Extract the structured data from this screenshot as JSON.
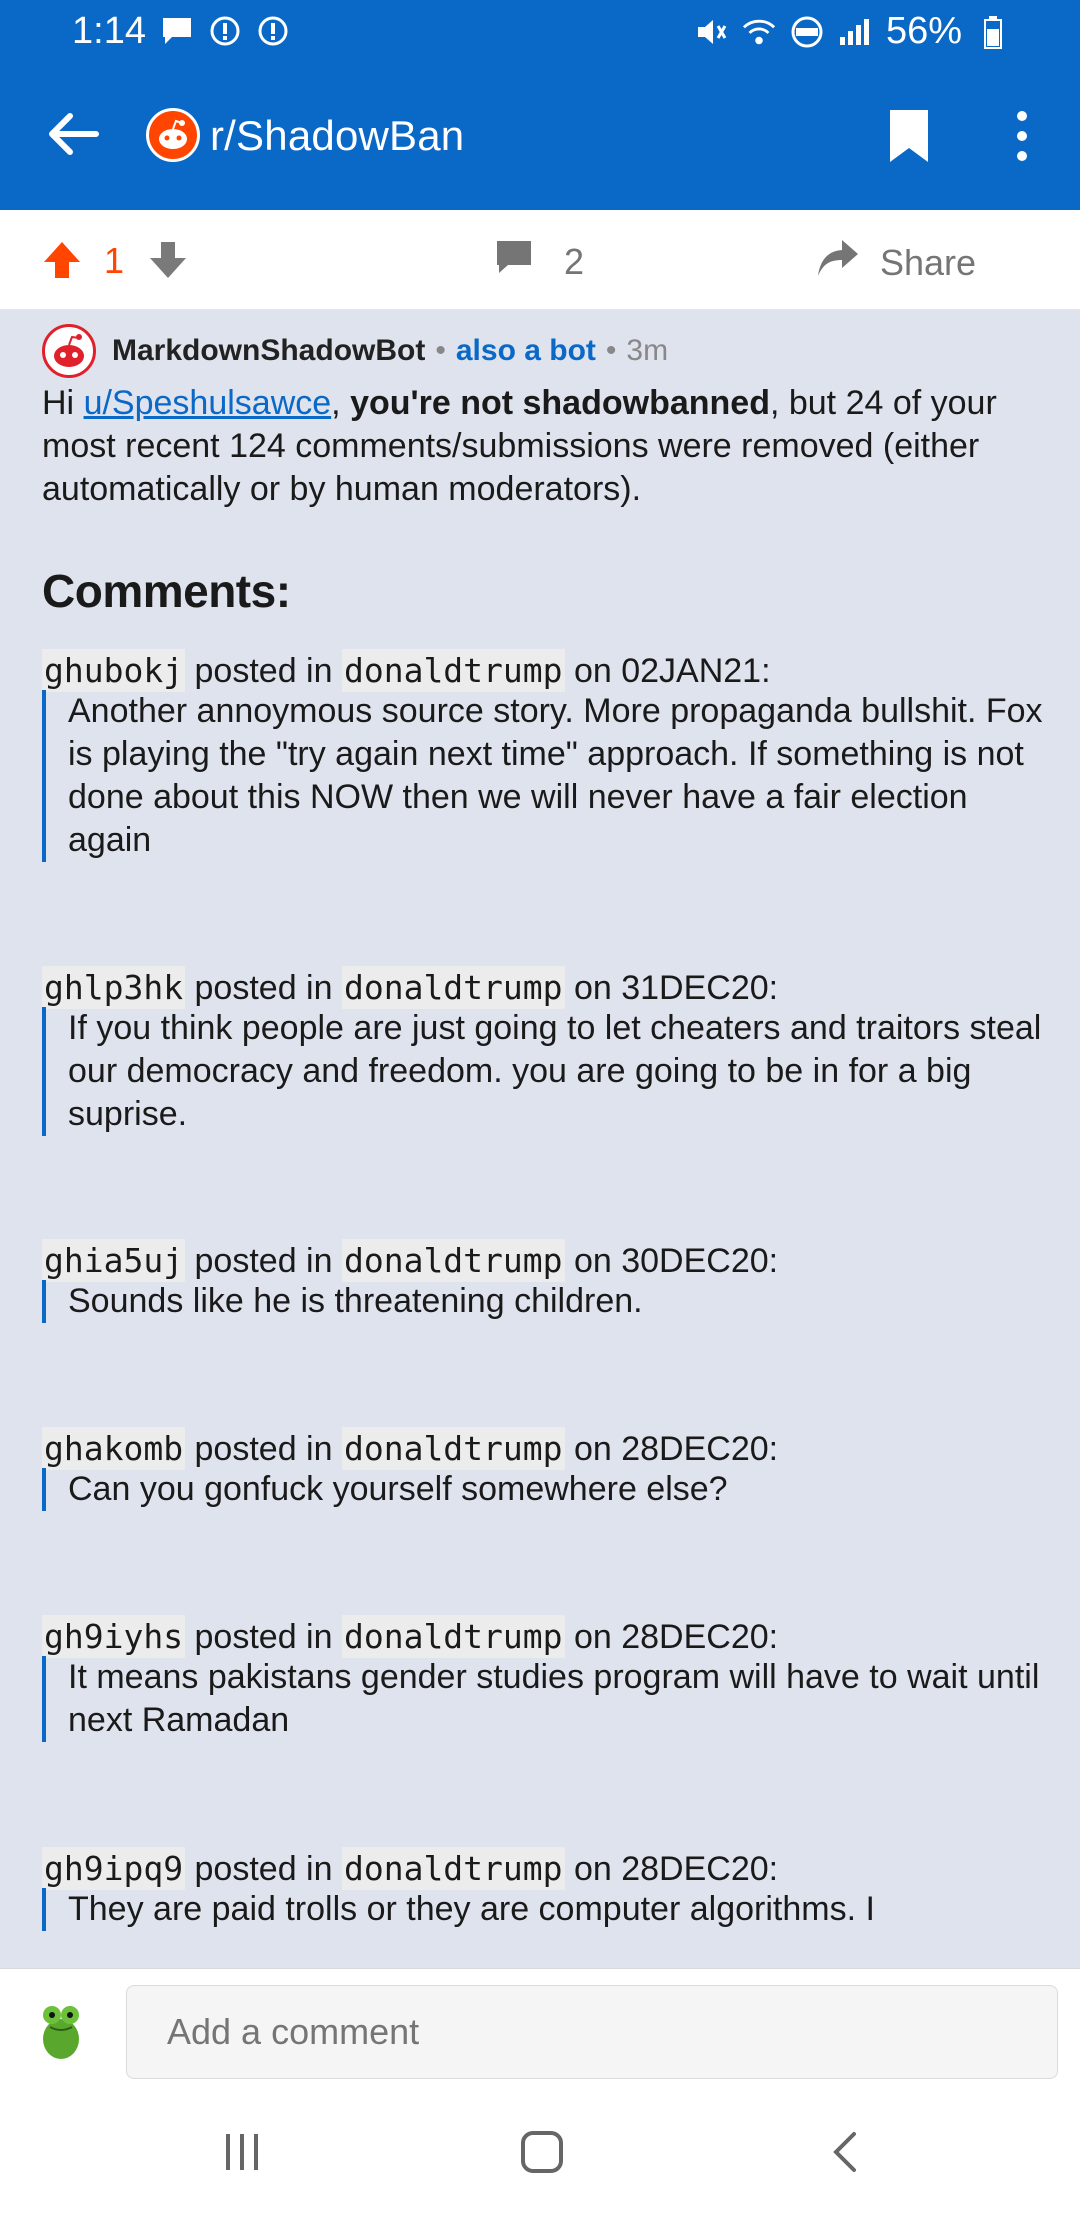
{
  "status": {
    "time": "1:14",
    "battery": "56%",
    "icons": [
      "chat-icon",
      "alert-icon",
      "alert-icon",
      "mute-icon",
      "wifi-icon",
      "volte-icon",
      "signal-icon",
      "battery-icon"
    ]
  },
  "app_bar": {
    "subreddit": "r/ShadowBan",
    "accent": "#0a68c7"
  },
  "actions": {
    "vote_count": "1",
    "comment_count": "2",
    "share_label": "Share",
    "upvote_color": "#ff4500"
  },
  "comment": {
    "author": "MarkdownShadowBot",
    "separator": "•",
    "flair": "also a bot",
    "age": "3m",
    "intro_hi": "Hi ",
    "intro_user": "u/Speshulsawce",
    "intro_comma": ", ",
    "intro_bold": "you're not shadowbanned",
    "intro_rest": ", but 24 of your most recent 124 comments/submissions were removed (either automatically or by human moderators).",
    "heading": "Comments:",
    "entries": [
      {
        "id": "ghubokj",
        "posted_in": " posted in ",
        "sub": "donaldtrump",
        "on": " on 02JAN21:",
        "quote": "Another annoymous source story. More propaganda bullshit. Fox is playing the \"try again next time\" approach. If something is not done about this NOW then we will never have a fair election again"
      },
      {
        "id": "ghlp3hk",
        "posted_in": " posted in ",
        "sub": "donaldtrump",
        "on": " on 31DEC20:",
        "quote": "If you think people are just going to let cheaters and traitors steal our democracy and freedom. you are going to be in for a big suprise."
      },
      {
        "id": "ghia5uj",
        "posted_in": " posted in ",
        "sub": "donaldtrump",
        "on": " on 30DEC20:",
        "quote": "Sounds like he is threatening children."
      },
      {
        "id": "ghakomb",
        "posted_in": " posted in ",
        "sub": "donaldtrump",
        "on": " on 28DEC20:",
        "quote": "Can you gonfuck yourself somewhere else?"
      },
      {
        "id": "gh9iyhs",
        "posted_in": " posted in ",
        "sub": "donaldtrump",
        "on": " on 28DEC20:",
        "quote": "It means pakistans gender studies program will have to wait until next Ramadan"
      },
      {
        "id": "gh9ipq9",
        "posted_in": " posted in ",
        "sub": "donaldtrump",
        "on": " on 28DEC20:",
        "quote": "They are paid trolls or they are computer algorithms. I"
      }
    ]
  },
  "composer": {
    "placeholder": "Add a comment"
  }
}
